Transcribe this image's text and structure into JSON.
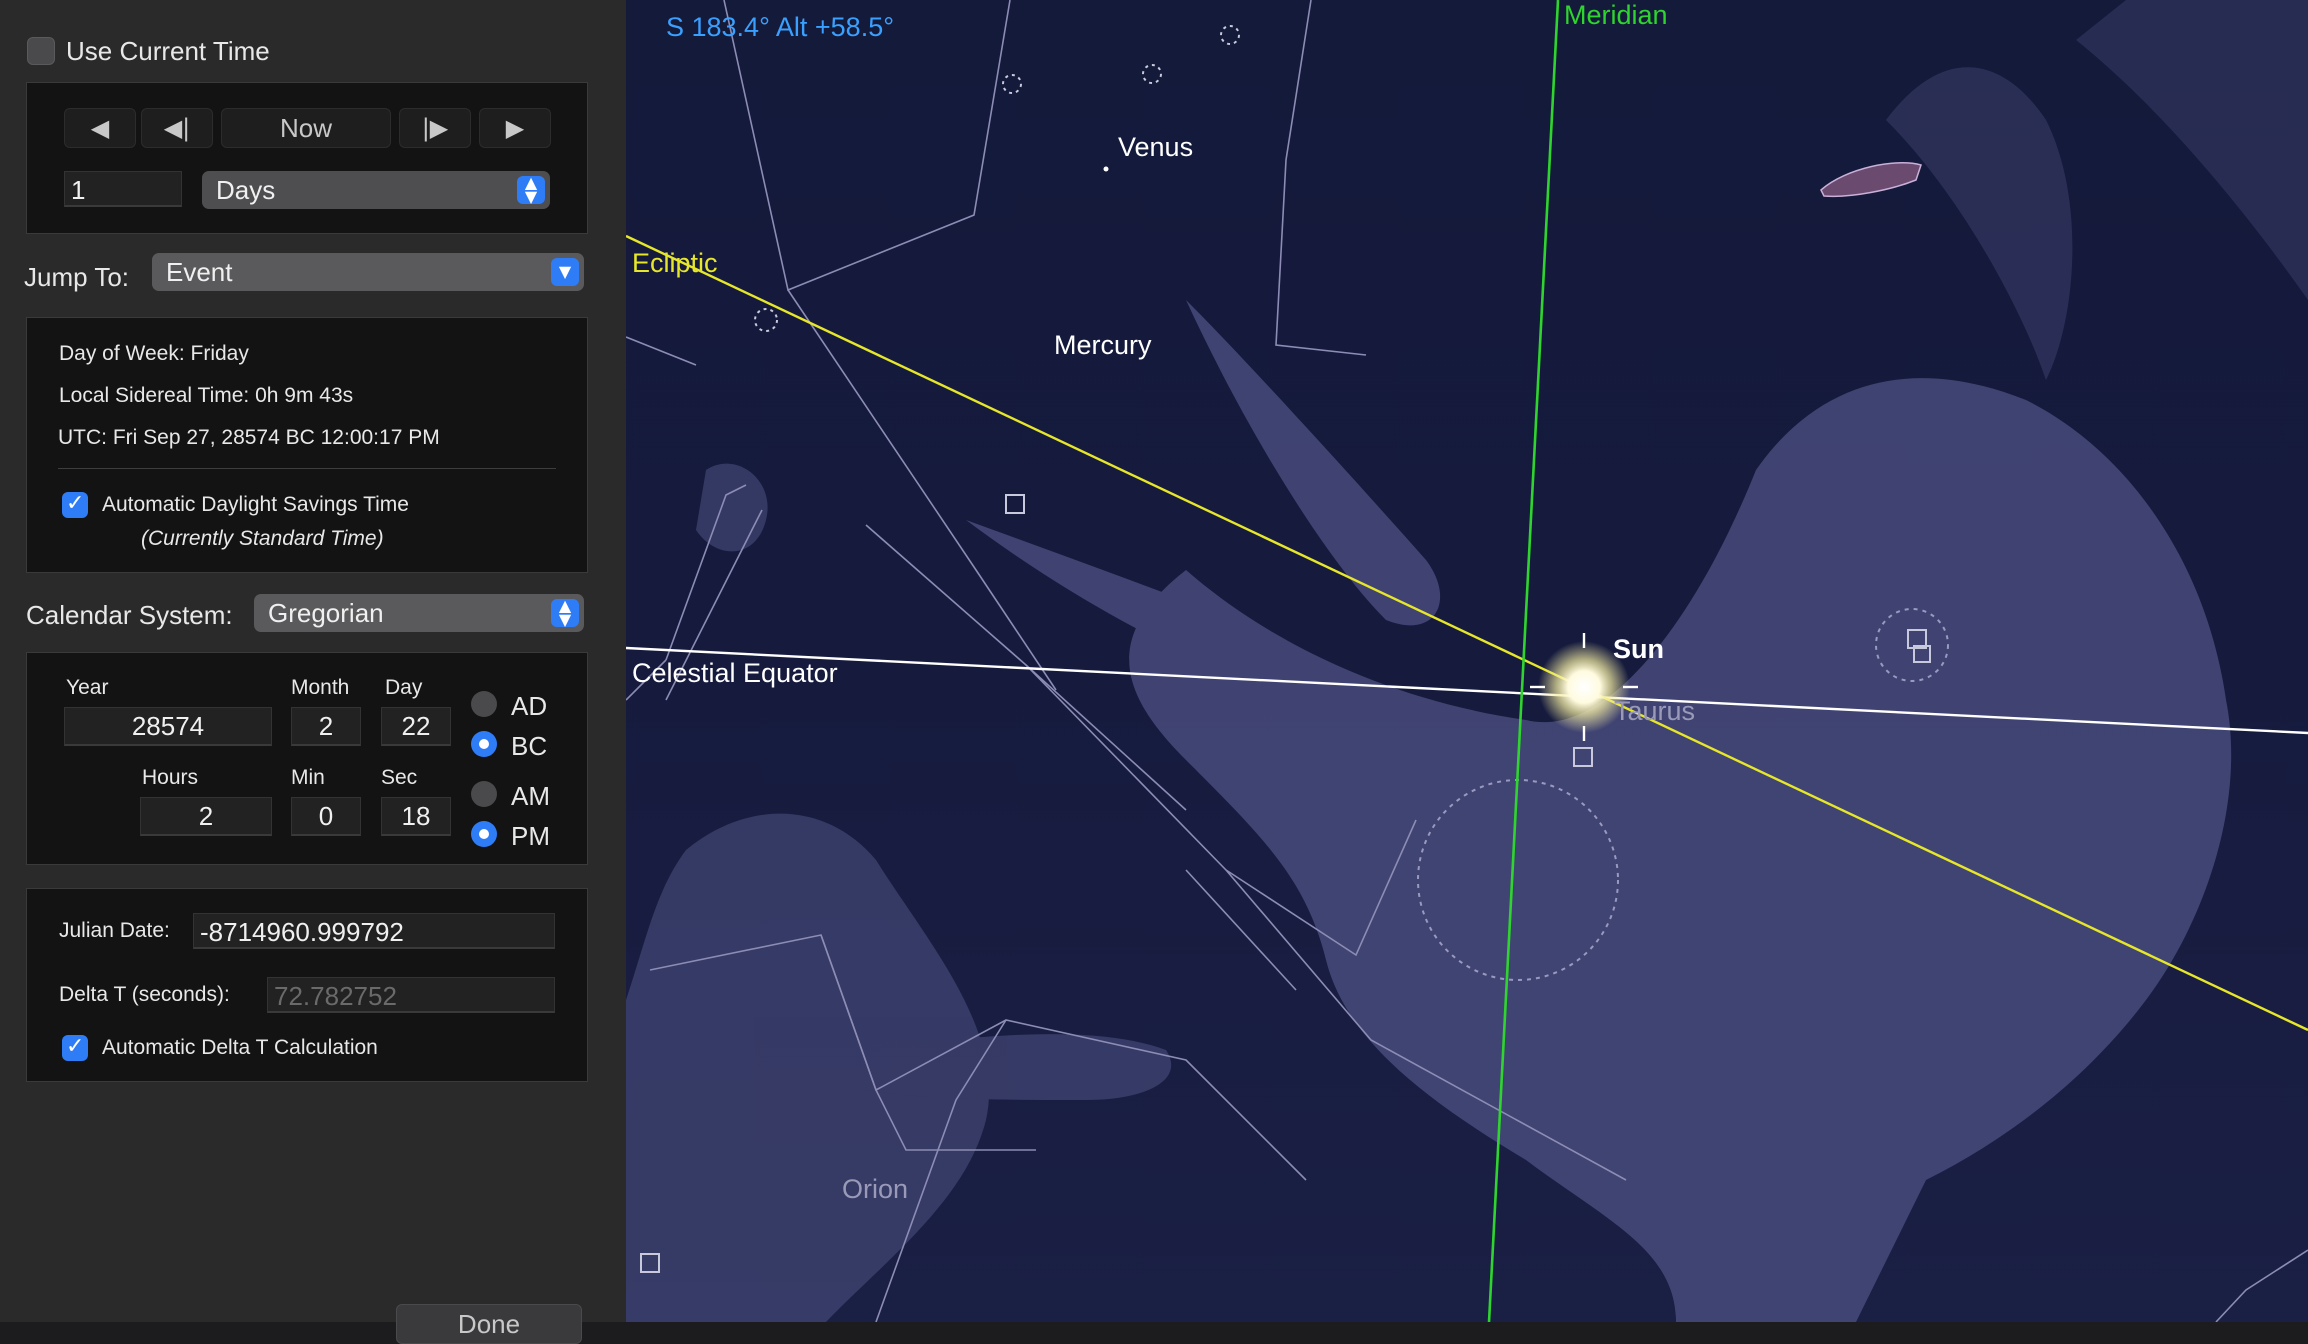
{
  "time_controls": {
    "use_current_time_label": "Use Current Time",
    "use_current_time_checked": false,
    "step_buttons": {
      "back_fast": "◀",
      "back_step": "◀|",
      "now": "Now",
      "forward_step": "|▶",
      "forward_fast": "▶"
    },
    "step_amount": "1",
    "step_unit": "Days"
  },
  "jump_to": {
    "label": "Jump To:",
    "selected": "Event"
  },
  "info": {
    "day_of_week_label": "Day of Week:",
    "day_of_week": "Friday",
    "sidereal_label": "Local Sidereal Time:",
    "sidereal_time": "0h 9m 43s",
    "utc_label": "UTC:",
    "utc": "Fri Sep 27, 28574 BC 12:00:17 PM",
    "dst_label": "Automatic Daylight Savings Time",
    "dst_checked": true,
    "dst_status": "(Currently Standard Time)"
  },
  "calendar": {
    "label": "Calendar System:",
    "selected": "Gregorian"
  },
  "date_time": {
    "year_label": "Year",
    "year": "28574",
    "month_label": "Month",
    "month": "2",
    "day_label": "Day",
    "day": "22",
    "hours_label": "Hours",
    "hours": "2",
    "min_label": "Min",
    "min": "0",
    "sec_label": "Sec",
    "sec": "18",
    "era_options": [
      "AD",
      "BC"
    ],
    "era_selected": "BC",
    "ampm_options": [
      "AM",
      "PM"
    ],
    "ampm_selected": "PM"
  },
  "julian": {
    "julian_label": "Julian Date:",
    "julian_date": "-8714960.999792",
    "delta_t_label": "Delta T (seconds):",
    "delta_t": "72.782752",
    "auto_delta_label": "Automatic Delta T Calculation",
    "auto_delta_checked": true
  },
  "done_label": "Done",
  "sky": {
    "coords": "S 183.4° Alt +58.5°",
    "meridian_label": "Meridian",
    "ecliptic_label": "Ecliptic",
    "celestial_equator_label": "Celestial Equator",
    "objects": {
      "venus": "Venus",
      "mercury": "Mercury",
      "sun": "Sun",
      "taurus": "Taurus",
      "orion": "Orion"
    },
    "colors": {
      "meridian": "#2fd42f",
      "ecliptic": "#e6e62a",
      "equator": "#ffffff",
      "coords": "#3aa0ff",
      "figure": "#8a8ab8"
    }
  }
}
